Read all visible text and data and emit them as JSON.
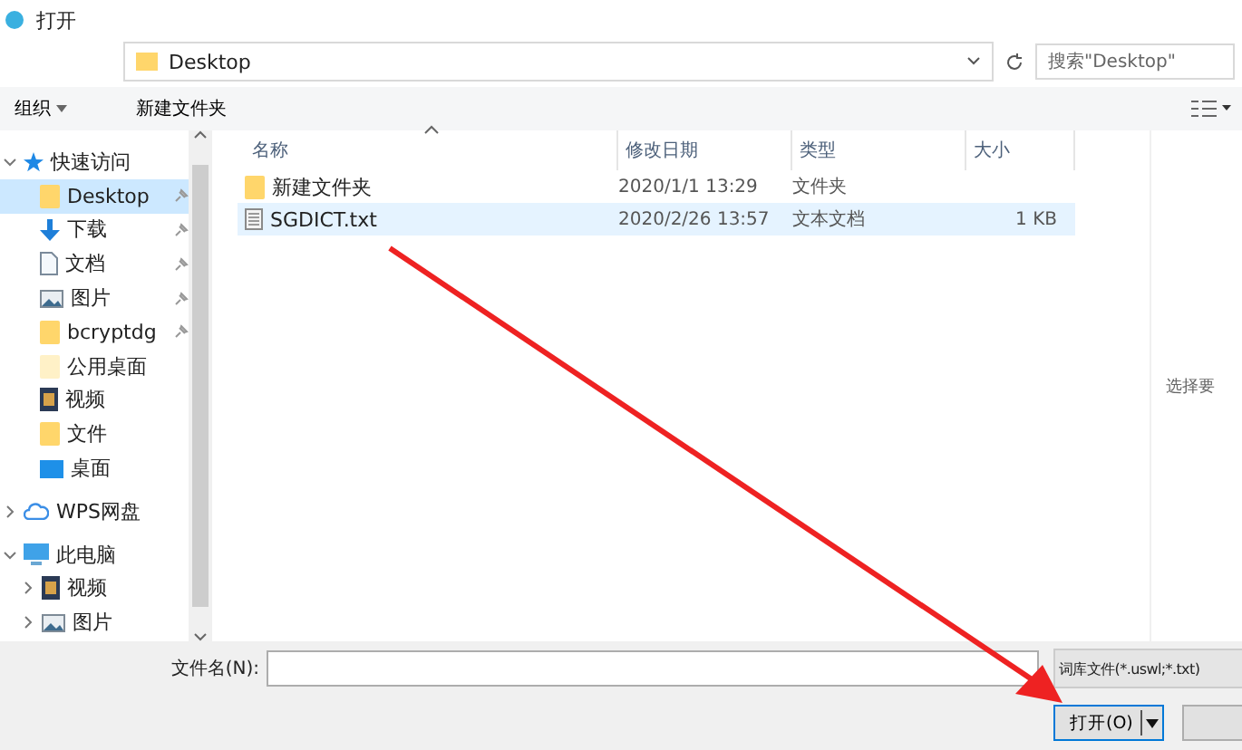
{
  "window": {
    "title": "打开"
  },
  "address_bar": {
    "path": [
      "Desktop"
    ],
    "search_placeholder": "搜索\"Desktop\""
  },
  "toolbar": {
    "organize": "组织",
    "new_folder": "新建文件夹"
  },
  "sidebar": {
    "items": [
      {
        "label": "快速访问",
        "kind": "star",
        "expanded": true,
        "selected": false,
        "children": [
          {
            "label": "Desktop",
            "kind": "folder",
            "pinned": true,
            "selected": true
          },
          {
            "label": "下载",
            "kind": "download",
            "pinned": true,
            "selected": false
          },
          {
            "label": "文档",
            "kind": "document",
            "pinned": true,
            "selected": false
          },
          {
            "label": "图片",
            "kind": "image",
            "pinned": true,
            "selected": false
          },
          {
            "label": "bcryptdg",
            "kind": "folder",
            "pinned": true,
            "selected": false
          },
          {
            "label": "公用桌面",
            "kind": "palefolder",
            "pinned": false,
            "selected": false
          },
          {
            "label": "视频",
            "kind": "video",
            "pinned": false,
            "selected": false
          },
          {
            "label": "文件",
            "kind": "folder",
            "pinned": false,
            "selected": false
          },
          {
            "label": "桌面",
            "kind": "desktop",
            "pinned": false,
            "selected": false
          }
        ]
      },
      {
        "label": "WPS网盘",
        "kind": "cloud",
        "expanded": false,
        "selected": false
      },
      {
        "label": "此电脑",
        "kind": "pc",
        "expanded": true,
        "selected": false,
        "children": [
          {
            "label": "视频",
            "kind": "video",
            "expanded": false,
            "selected": false
          },
          {
            "label": "图片",
            "kind": "image",
            "expanded": false,
            "selected": false
          }
        ]
      }
    ]
  },
  "table": {
    "columns": [
      "名称",
      "修改日期",
      "类型",
      "大小"
    ],
    "rows": [
      {
        "kind": "folder",
        "name": "新建文件夹",
        "date": "2020/1/1 13:29",
        "type": "文件夹",
        "selected": false
      },
      {
        "kind": "text",
        "name": "SGDICT.txt",
        "date": "2020/2/26 13:57",
        "type": "文本文档",
        "size": "1 KB",
        "selected": true
      }
    ]
  },
  "preview": {
    "hint": "选择要"
  },
  "footer": {
    "filename_label": "文件名(N):",
    "filter": "词库文件(*.uswl;*.txt)",
    "open_button": "打开(O)"
  }
}
